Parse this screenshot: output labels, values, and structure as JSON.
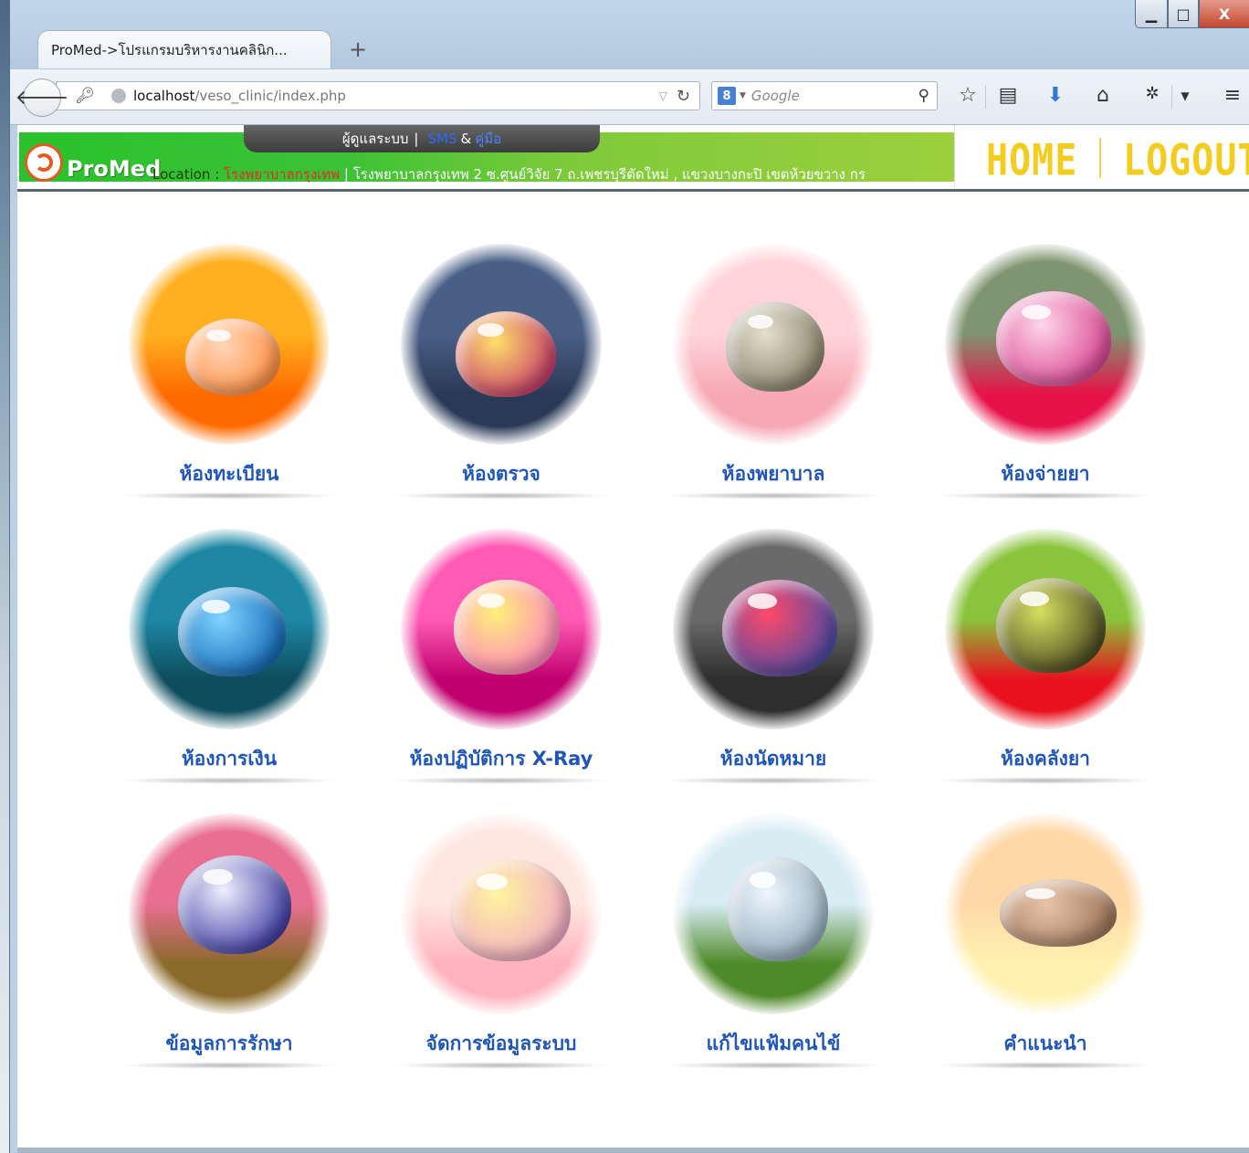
{
  "browser": {
    "tab_title": "ProMed->โปรแกรมบริหารงานคลินิก...",
    "new_tab_symbol": "+",
    "url_host": "localhost",
    "url_path": "/veso_clinic/index.php",
    "search_placeholder": "Google",
    "search_engine_letter": "8",
    "window_controls": {
      "minimize": "▁",
      "maximize": "□",
      "close": "X"
    }
  },
  "app": {
    "login_label": "ผู้ดูแลระบบ",
    "separator": "|",
    "sms_label": "SMS",
    "amp": "&",
    "manual_label": "คู่มือ",
    "logo_text": "ProMed",
    "location_label": "Location :",
    "hospital_name": "โรงพยาบาลกรุงเทพ",
    "hospital_address": "| โรงพยาบาลกรุงเทพ 2 ซ.ศูนย์วิจัย 7 ถ.เพชรบุรีตัดใหม่ , แขวงบางกะปิ เขตห้วยขวาง กร",
    "home_label": "HOME",
    "logout_label": "LOGOUT"
  },
  "menu": [
    {
      "label": "ห้องทะเบียน",
      "icon": "orange-droplet-icon",
      "colors": {
        "bg1": "#ffb020",
        "bg2": "#ff6a00",
        "drop1": "#ffd6b8",
        "drop2": "#ff8a3a"
      }
    },
    {
      "label": "ห้องตรวจ",
      "icon": "navy-pink-droplet-icon",
      "colors": {
        "bg1": "#4a5f86",
        "bg2": "#2a3956",
        "drop1": "#ffe06a",
        "drop2": "#c02a6a"
      }
    },
    {
      "label": "ห้องพยาบาล",
      "icon": "pink-droplet-icon",
      "colors": {
        "bg1": "#ffd4d8",
        "bg2": "#f6a8b4",
        "drop1": "#e4e0d0",
        "drop2": "#807a60"
      }
    },
    {
      "label": "ห้องจ่ายยา",
      "icon": "red-petal-droplet-icon",
      "colors": {
        "bg1": "#7f9470",
        "bg2": "#e8124a",
        "drop1": "#ffd6ea",
        "drop2": "#d6398a"
      }
    },
    {
      "label": "ห้องการเงิน",
      "icon": "blue-droplet-icon",
      "colors": {
        "bg1": "#1e88a4",
        "bg2": "#0d4d5e",
        "drop1": "#7fd4ff",
        "drop2": "#0a5fb0"
      }
    },
    {
      "label": "ห้องปฏิบัติการ X-Ray",
      "icon": "magenta-droplet-icon",
      "colors": {
        "bg1": "#ff5ab4",
        "bg2": "#c0006e",
        "drop1": "#fff07a",
        "drop2": "#ff7ac4"
      }
    },
    {
      "label": "ห้องนัดหมาย",
      "icon": "dark-droplet-icon",
      "colors": {
        "bg1": "#6a6a6a",
        "bg2": "#2e2e2e",
        "drop1": "#ff4a6a",
        "drop2": "#3a4aa8"
      }
    },
    {
      "label": "ห้องคลังยา",
      "icon": "green-red-droplet-icon",
      "colors": {
        "bg1": "#8ac43c",
        "bg2": "#e8121e",
        "drop1": "#d8e060",
        "drop2": "#3a3a1a"
      }
    },
    {
      "label": "ข้อมูลการรักษา",
      "icon": "spider-droplet-icon",
      "colors": {
        "bg1": "#e86e92",
        "bg2": "#8a6a2a",
        "drop1": "#f0f0ff",
        "drop2": "#2a2a9a"
      }
    },
    {
      "label": "จัดการข้อมูลระบบ",
      "icon": "peach-droplet-icon",
      "colors": {
        "bg1": "#ffe6e0",
        "bg2": "#ffb2bd",
        "drop1": "#fff4a0",
        "drop2": "#f0a4c8"
      }
    },
    {
      "label": "แก้ไขแฟ้มคนไข้",
      "icon": "dandelion-droplet-icon",
      "colors": {
        "bg1": "#d8ecf4",
        "bg2": "#4f8a2a",
        "drop1": "#eef6ff",
        "drop2": "#8aa4b4"
      }
    },
    {
      "label": "คำแนะนำ",
      "icon": "cream-droplet-icon",
      "colors": {
        "bg1": "#ffd8a8",
        "bg2": "#fff2b0",
        "drop1": "#e8c4a8",
        "drop2": "#9c7458"
      }
    }
  ]
}
